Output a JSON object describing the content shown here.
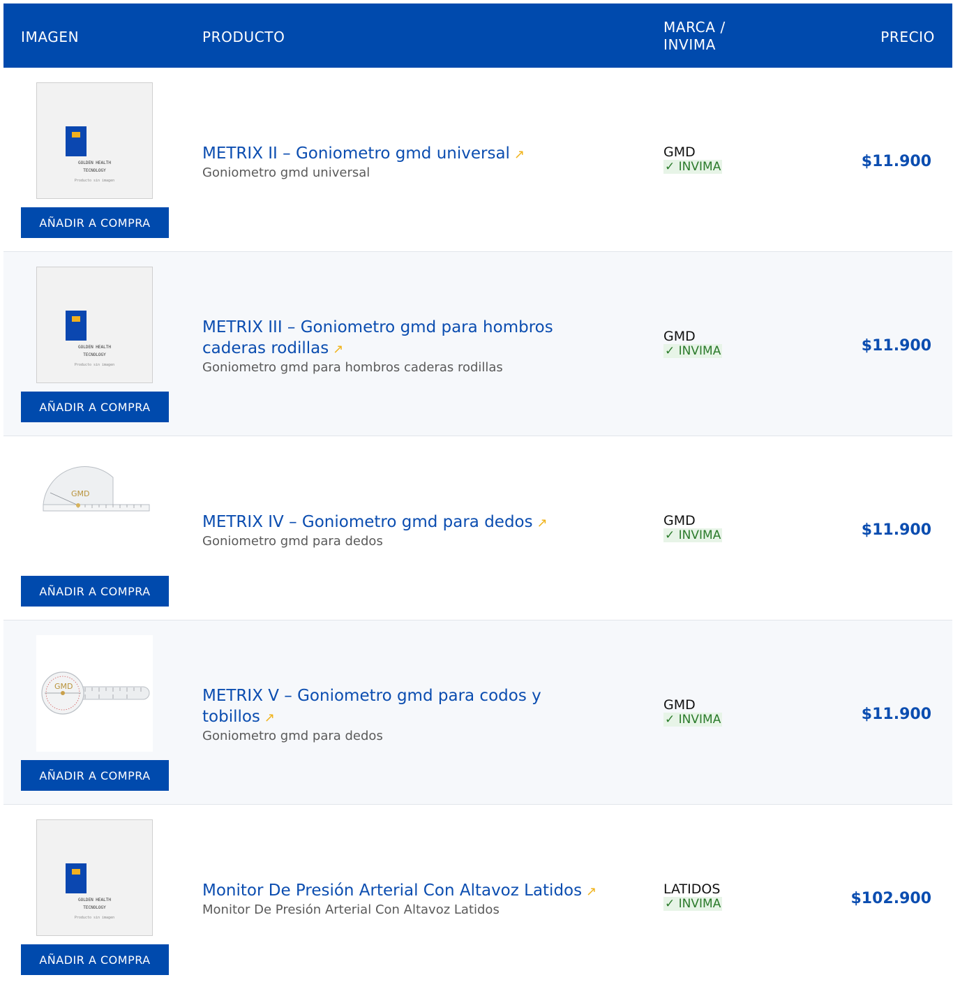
{
  "header": {
    "imagen": "IMAGEN",
    "producto": "PRODUCTO",
    "marca_line1": "MARCA /",
    "marca_line2": "INVIMA",
    "precio": "PRECIO"
  },
  "placeholder": {
    "line1": "GOLDEN HEALTH",
    "line2": "TECNOLOGY",
    "line3": "Producto sin imagen",
    "logo_color": "#0b47b0",
    "logo_accent": "#f2b01e"
  },
  "button_label": "AÑADIR A COMPRA",
  "invima_badge": "✓ INVIMA",
  "link_arrow": "↗",
  "colors": {
    "primary": "#004aad",
    "link": "#0b4db0",
    "arrow": "#f0b31b",
    "invima": "#2a7a2a"
  },
  "products": [
    {
      "title": "METRIX II – Goniometro gmd universal",
      "subtitle": "Goniometro gmd universal",
      "brand": "GMD",
      "price": "$11.900",
      "image": "placeholder"
    },
    {
      "title": "METRIX III – Goniometro gmd para hombros caderas rodillas",
      "subtitle": "Goniometro gmd para hombros caderas rodillas",
      "brand": "GMD",
      "price": "$11.900",
      "image": "placeholder"
    },
    {
      "title": "METRIX IV – Goniometro gmd para dedos",
      "subtitle": "Goniometro gmd para dedos",
      "brand": "GMD",
      "price": "$11.900",
      "image": "goniometer-half",
      "image_label": "GMD"
    },
    {
      "title": "METRIX V – Goniometro gmd para codos y tobillos",
      "subtitle": "Goniometro gmd para dedos",
      "brand": "GMD",
      "price": "$11.900",
      "image": "goniometer-full",
      "image_label": "GMD"
    },
    {
      "title": "Monitor De Presión Arterial Con Altavoz Latidos",
      "subtitle": "Monitor De Presión Arterial Con Altavoz Latidos",
      "brand": "LATIDOS",
      "price": "$102.900",
      "image": "placeholder"
    }
  ]
}
